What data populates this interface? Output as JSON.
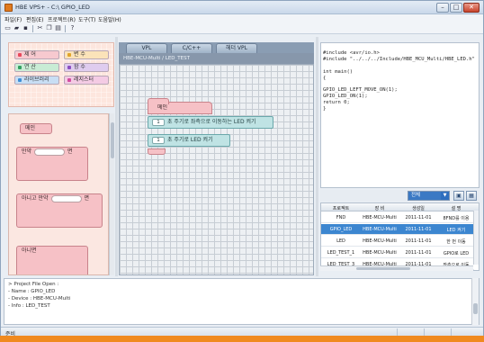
{
  "window": {
    "title": "HBE VPS+ - C:\\ GPIO_LED"
  },
  "menubar": [
    "파일(F)",
    "편집(E)",
    "프로젝트(R)",
    "도구(T)",
    "도움말(H)"
  ],
  "toolbar": {
    "icons": [
      "new-file-icon",
      "open-folder-icon",
      "save-icon",
      "cut-icon",
      "copy-icon",
      "paste-icon",
      "help-icon"
    ]
  },
  "palette": {
    "categories": [
      {
        "label": "제 어",
        "color": "#e8485b"
      },
      {
        "label": "변 수",
        "color": "#e1a42a"
      },
      {
        "label": "연 산",
        "color": "#33a061"
      },
      {
        "label": "함 수",
        "color": "#8c4fc2"
      },
      {
        "label": "라이브러리",
        "color": "#3f8fd6"
      },
      {
        "label": "레지스터",
        "color": "#d24da0"
      }
    ],
    "blocks": [
      {
        "label": "메인"
      },
      {
        "label": "만약",
        "suffix": "면"
      },
      {
        "label": "아니고 만약",
        "suffix": "면"
      },
      {
        "label": "아니면"
      }
    ]
  },
  "canvas": {
    "tabs": [
      "VPL",
      "C/C++",
      "헤더 VPL"
    ],
    "header_text": "HBE-MCU-Multi / LED_TEST",
    "main_block": "메인",
    "commands": [
      {
        "value": "1",
        "label": "초 주기로 좌측으로 이동하는 LED 켜기"
      },
      {
        "value": "1",
        "label": "초 주기로 LED 켜기"
      }
    ]
  },
  "code": {
    "lines": [
      "#include <avr/io.h>",
      "#include \"../../../Include/HBE_MCU_Multi/HBE_LED.h\"",
      "",
      "int main()",
      "{",
      "    GPIO_LED_LEFT_MOVE_ON(1);",
      "    GPIO_LED_ON(1);",
      "    return 0;",
      "}"
    ]
  },
  "project": {
    "selected_view": "전체",
    "columns": [
      "프로젝트",
      "장 비",
      "생성일",
      "설 명"
    ],
    "rows": [
      {
        "name": "FND",
        "device": "HBE-MCU-Multi",
        "date": "2011-11-01",
        "desc": "8FND를 이용"
      },
      {
        "name": "GPIO_LED",
        "device": "HBE-MCU-Multi",
        "date": "2011-11-01",
        "desc": "LED 켜기"
      },
      {
        "name": "LED",
        "device": "HBE-MCU-Multi",
        "date": "2011-11-01",
        "desc": "한 번 이동"
      },
      {
        "name": "LED_TEST_1",
        "device": "HBE-MCU-Multi",
        "date": "2011-11-01",
        "desc": "GPIO로 LED"
      },
      {
        "name": "LED_TEST_3",
        "device": "HBE-MCU-Multi",
        "date": "2011-11-01",
        "desc": "좌측으로 이동"
      }
    ],
    "selected_index": 1
  },
  "console": {
    "lines": [
      "> Project File Open :",
      "  - Name : GPIO_LED",
      "  - Device : HBE-MCU-Multi",
      "  - Info : LED_TEST"
    ]
  },
  "status": {
    "text": "준비"
  }
}
